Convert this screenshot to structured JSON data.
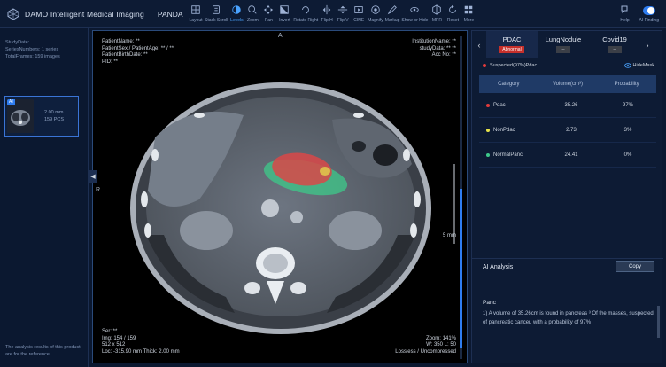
{
  "app": {
    "name": "DAMO Intelligent Medical Imaging",
    "module": "PANDA"
  },
  "toolbar": {
    "tools": [
      {
        "label": "Layout",
        "icon": "layout-icon"
      },
      {
        "label": "Stack Scroll",
        "icon": "stack-scroll-icon"
      },
      {
        "label": "Levels",
        "icon": "levels-icon"
      },
      {
        "label": "Zoom",
        "icon": "zoom-icon"
      },
      {
        "label": "Pan",
        "icon": "pan-icon"
      },
      {
        "label": "Invert",
        "icon": "invert-icon"
      },
      {
        "label": "Rotate Right",
        "icon": "rotate-right-icon"
      },
      {
        "label": "Flip H",
        "icon": "flip-h-icon"
      },
      {
        "label": "Flip V",
        "icon": "flip-v-icon"
      },
      {
        "label": "CINE",
        "icon": "cine-icon"
      },
      {
        "label": "Magnify",
        "icon": "magnify-icon"
      },
      {
        "label": "Markup",
        "icon": "markup-icon"
      },
      {
        "label": "Show or Hide",
        "icon": "show-hide-icon"
      },
      {
        "label": "MPR",
        "icon": "mpr-icon"
      },
      {
        "label": "Reset",
        "icon": "reset-icon"
      },
      {
        "label": "More",
        "icon": "more-icon"
      }
    ],
    "help_label": "Help",
    "ai_finding_label": "AI Finding"
  },
  "left_panel": {
    "study_date": "StudyDate:",
    "series_numbers": "SeriesNumbers:  1 series",
    "total_frames": "TotalFrames:  159 images",
    "series": {
      "badge": "AI",
      "thickness": "2.00 mm",
      "count": "159 PCS"
    },
    "disclaimer": "The analysis results of this product are for the reference"
  },
  "viewport": {
    "tl": [
      "PatientName: **",
      "PatientSex / PatientAge: ** / **",
      "PatientBirthDate: **",
      "PID: **"
    ],
    "tr": [
      "InstitutionName: **",
      "studyData: ** **",
      "Acc No: **"
    ],
    "bl": [
      "Ser: **",
      "Img: 154 / 159",
      "512 x 512",
      "Loc: -315.90 mm Thick: 2.00 mm"
    ],
    "br": [
      "Zoom: 141%",
      "W: 350 L: 50",
      "Lossless / Uncompressed"
    ],
    "orient_top": "A",
    "orient_left": "R",
    "scale": "5 mm"
  },
  "right_panel": {
    "tabs": [
      {
        "label": "PDAC",
        "badge": "Abnormal"
      },
      {
        "label": "LungNodule",
        "badge": "--"
      },
      {
        "label": "Covid19",
        "badge": "--"
      }
    ],
    "suspect": "Suspected(97%)Pdac",
    "hide_mask": "HideMask",
    "table": {
      "headers": [
        "Category",
        "Volume(cm³)",
        "Probability"
      ],
      "rows": [
        {
          "category": "Pdac",
          "volume": "35.26",
          "probability": "97%",
          "color": "#e23b3b"
        },
        {
          "category": "NonPdac",
          "volume": "2.73",
          "probability": "3%",
          "color": "#e7e34a"
        },
        {
          "category": "NormalPanc",
          "volume": "24.41",
          "probability": "0%",
          "color": "#3ec98a"
        }
      ]
    },
    "ai_analysis": "AI Analysis",
    "copy_label": "Copy",
    "panc_title": "Panc",
    "analysis": "1)  A volume of 35.26cm is found in pancreas ³ Of the masses, suspected of pancreatic cancer, with a probability of 97%"
  }
}
